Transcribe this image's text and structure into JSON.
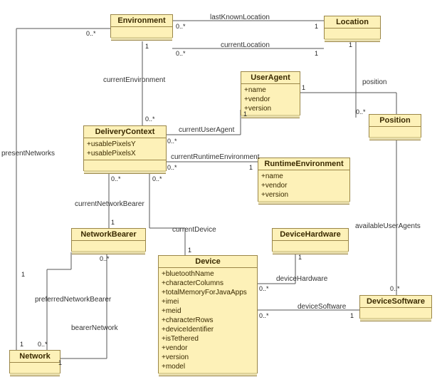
{
  "classes": {
    "Environment": {
      "name": "Environment",
      "attrs": []
    },
    "Location": {
      "name": "Location",
      "attrs": []
    },
    "UserAgent": {
      "name": "UserAgent",
      "attrs": [
        "+name",
        "+vendor",
        "+version"
      ]
    },
    "Position": {
      "name": "Position",
      "attrs": []
    },
    "DeliveryContext": {
      "name": "DeliveryContext",
      "attrs": [
        "+usablePixelsY",
        "+usablePixelsX"
      ]
    },
    "RuntimeEnvironment": {
      "name": "RuntimeEnvironment",
      "attrs": [
        "+name",
        "+vendor",
        "+version"
      ]
    },
    "NetworkBearer": {
      "name": "NetworkBearer",
      "attrs": []
    },
    "DeviceHardware": {
      "name": "DeviceHardware",
      "attrs": []
    },
    "Device": {
      "name": "Device",
      "attrs": [
        "+bluetoothName",
        "+characterColumns",
        "+totalMemoryForJavaApps",
        "+imei",
        "+meid",
        "+characterRows",
        "+deviceIdentifier",
        "+isTethered",
        "+vendor",
        "+version",
        "+model"
      ]
    },
    "DeviceSoftware": {
      "name": "DeviceSoftware",
      "attrs": []
    },
    "Network": {
      "name": "Network",
      "attrs": []
    }
  },
  "associations": {
    "lastKnownLocation": {
      "label": "lastKnownLocation",
      "endA": "0..*",
      "endB": "1"
    },
    "currentLocation": {
      "label": "currentLocation",
      "endA": "0..*",
      "endB": "1"
    },
    "currentEnvironment": {
      "label": "currentEnvironment",
      "endA": "1",
      "endB": "0..*"
    },
    "currentUserAgent": {
      "label": "currentUserAgent",
      "endA": "0..*",
      "endB": "1"
    },
    "position": {
      "label": "position",
      "endA": "1",
      "endB": "0..*"
    },
    "currentRuntimeEnvironment": {
      "label": "currentRuntimeEnvironment",
      "endA": "0..*",
      "endB": "1"
    },
    "currentNetworkBearer": {
      "label": "currentNetworkBearer",
      "endA": "0..*",
      "endB": "1"
    },
    "currentDevice": {
      "label": "currentDevice",
      "endA": "0..*",
      "endB": "1"
    },
    "deviceHardware": {
      "label": "deviceHardware",
      "endA": "1",
      "endB": "0..*"
    },
    "deviceSoftware": {
      "label": "deviceSoftware",
      "endA": "0..*",
      "endB": "1"
    },
    "availableUserAgents": {
      "label": "availableUserAgents",
      "endA": "1",
      "endB": "0..*"
    },
    "presentNetworks": {
      "label": "presentNetworks",
      "endA": "0..*",
      "endB": "1"
    },
    "preferredNetworkBearer": {
      "label": "preferredNetworkBearer",
      "endA": "0..*",
      "endB": "1"
    },
    "bearerNetwork": {
      "label": "bearerNetwork",
      "endA": "0..*",
      "endB": "1"
    }
  },
  "chart_data": {
    "type": "diagram",
    "diagram_type": "UML class diagram",
    "classes": [
      {
        "name": "Environment",
        "attributes": []
      },
      {
        "name": "Location",
        "attributes": []
      },
      {
        "name": "UserAgent",
        "attributes": [
          "name",
          "vendor",
          "version"
        ]
      },
      {
        "name": "Position",
        "attributes": []
      },
      {
        "name": "DeliveryContext",
        "attributes": [
          "usablePixelsY",
          "usablePixelsX"
        ]
      },
      {
        "name": "RuntimeEnvironment",
        "attributes": [
          "name",
          "vendor",
          "version"
        ]
      },
      {
        "name": "NetworkBearer",
        "attributes": []
      },
      {
        "name": "DeviceHardware",
        "attributes": []
      },
      {
        "name": "Device",
        "attributes": [
          "bluetoothName",
          "characterColumns",
          "totalMemoryForJavaApps",
          "imei",
          "meid",
          "characterRows",
          "deviceIdentifier",
          "isTethered",
          "vendor",
          "version",
          "model"
        ]
      },
      {
        "name": "DeviceSoftware",
        "attributes": []
      },
      {
        "name": "Network",
        "attributes": []
      }
    ],
    "associations": [
      {
        "name": "lastKnownLocation",
        "between": [
          "Environment",
          "Location"
        ],
        "multiplicity": [
          "0..*",
          "1"
        ]
      },
      {
        "name": "currentLocation",
        "between": [
          "Environment",
          "Location"
        ],
        "multiplicity": [
          "0..*",
          "1"
        ]
      },
      {
        "name": "currentEnvironment",
        "between": [
          "Environment",
          "DeliveryContext"
        ],
        "multiplicity": [
          "1",
          "0..*"
        ]
      },
      {
        "name": "currentUserAgent",
        "between": [
          "DeliveryContext",
          "UserAgent"
        ],
        "multiplicity": [
          "0..*",
          "1"
        ]
      },
      {
        "name": "position",
        "between": [
          "Location",
          "Position"
        ],
        "multiplicity": [
          "1",
          "0..*"
        ]
      },
      {
        "name": "currentRuntimeEnvironment",
        "between": [
          "DeliveryContext",
          "RuntimeEnvironment"
        ],
        "multiplicity": [
          "0..*",
          "1"
        ]
      },
      {
        "name": "currentNetworkBearer",
        "between": [
          "DeliveryContext",
          "NetworkBearer"
        ],
        "multiplicity": [
          "0..*",
          "1"
        ]
      },
      {
        "name": "currentDevice",
        "between": [
          "DeliveryContext",
          "Device"
        ],
        "multiplicity": [
          "0..*",
          "1"
        ]
      },
      {
        "name": "deviceHardware",
        "between": [
          "DeviceHardware",
          "Device"
        ],
        "multiplicity": [
          "1",
          "0..*"
        ]
      },
      {
        "name": "deviceSoftware",
        "between": [
          "Device",
          "DeviceSoftware"
        ],
        "multiplicity": [
          "0..*",
          "1"
        ]
      },
      {
        "name": "availableUserAgents",
        "between": [
          "UserAgent",
          "DeviceSoftware"
        ],
        "multiplicity": [
          "1",
          "0..*"
        ]
      },
      {
        "name": "presentNetworks",
        "between": [
          "Environment",
          "Network"
        ],
        "multiplicity": [
          "0..*",
          "1"
        ]
      },
      {
        "name": "preferredNetworkBearer",
        "between": [
          "Network",
          "NetworkBearer"
        ],
        "multiplicity": [
          "0..*",
          "1"
        ]
      },
      {
        "name": "bearerNetwork",
        "between": [
          "NetworkBearer",
          "Network"
        ],
        "multiplicity": [
          "0..*",
          "1"
        ]
      }
    ]
  }
}
